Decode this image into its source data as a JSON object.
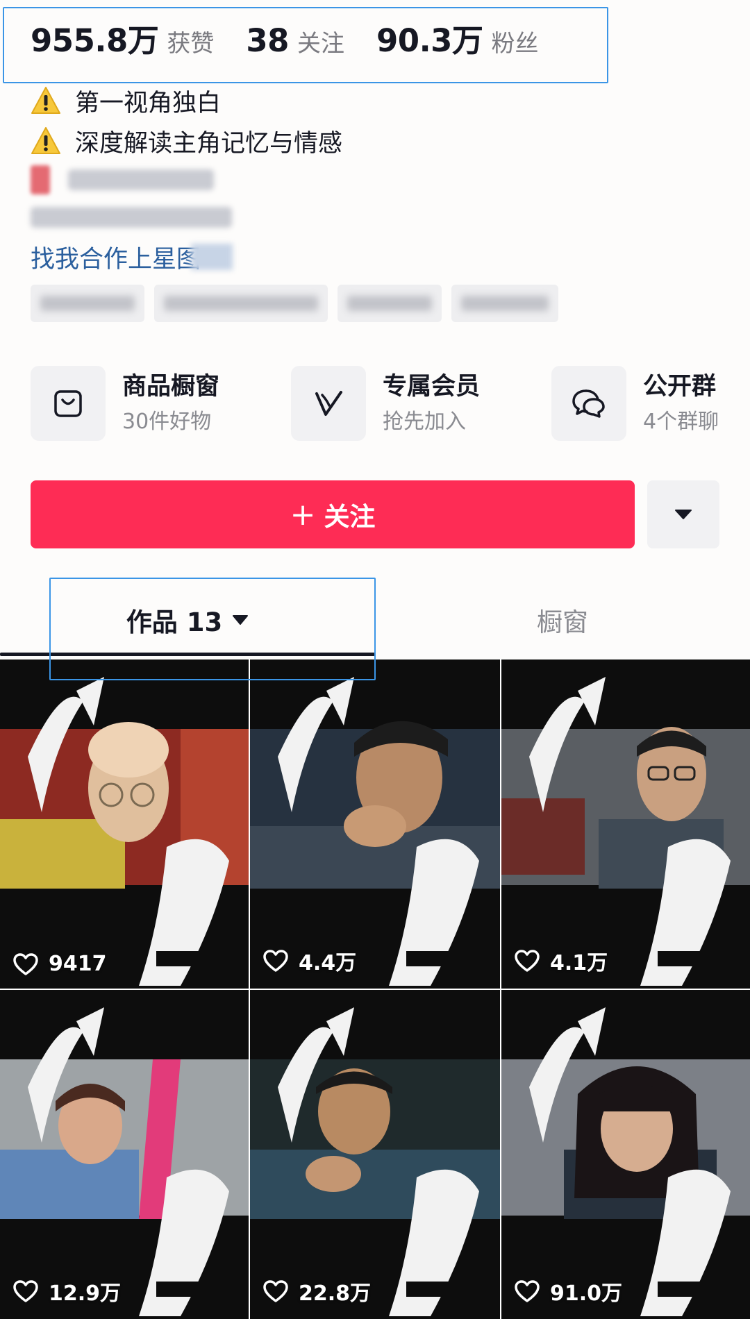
{
  "stats": [
    {
      "num": "955.8万",
      "label": "获赞"
    },
    {
      "num": "38",
      "label": "关注"
    },
    {
      "num": "90.3万",
      "label": "粉丝"
    }
  ],
  "bio": {
    "line1": "第一视角独白",
    "line2": "深度解读主角记忆与情感",
    "link": "找我合作上星图"
  },
  "features": [
    {
      "title": "商品橱窗",
      "sub": "30件好物",
      "icon": "bag-icon"
    },
    {
      "title": "专属会员",
      "sub": "抢先加入",
      "icon": "vip-icon"
    },
    {
      "title": "公开群",
      "sub": "4个群聊",
      "icon": "chat-bubbles-icon"
    }
  ],
  "follow": {
    "plus": "+",
    "label": "关注"
  },
  "tabs": {
    "works": "作品 13",
    "showcase": "橱窗"
  },
  "videos": [
    {
      "likes": "9417"
    },
    {
      "likes": "4.4万"
    },
    {
      "likes": "4.1万"
    },
    {
      "likes": "12.9万"
    },
    {
      "likes": "22.8万"
    },
    {
      "likes": "91.0万"
    }
  ],
  "colors": {
    "accent": "#fe2c55",
    "link": "#2b5f9e",
    "highlight": "#3b95e6"
  }
}
